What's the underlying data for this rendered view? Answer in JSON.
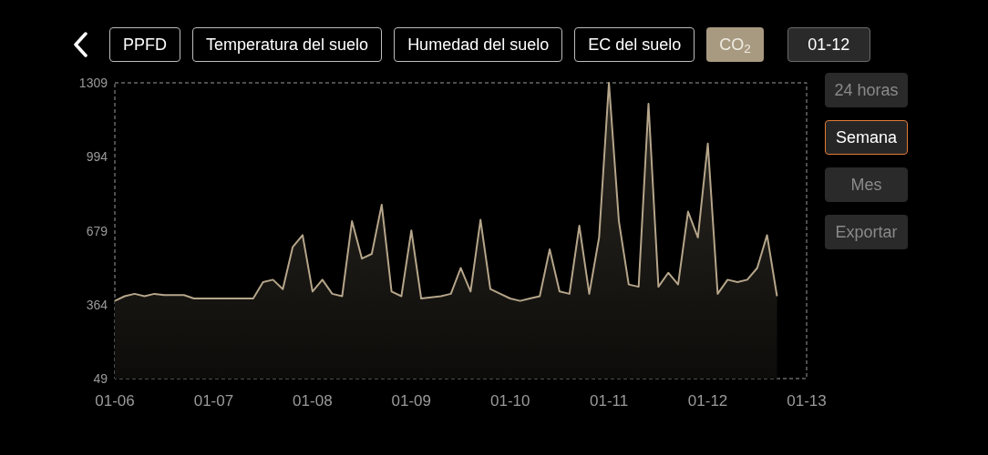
{
  "header": {
    "tabs": [
      {
        "label": "PPFD",
        "selected": false
      },
      {
        "label": "Temperatura del suelo",
        "selected": false
      },
      {
        "label": "Humedad del suelo",
        "selected": false
      },
      {
        "label": "EC del suelo",
        "selected": false
      },
      {
        "label": "CO$_{2}$",
        "selected": true
      }
    ],
    "date": "01-12"
  },
  "range_options": [
    {
      "label": "24 horas",
      "selected": false
    },
    {
      "label": "Semana",
      "selected": true
    },
    {
      "label": "Mes",
      "selected": false
    }
  ],
  "export_button": "Exportar",
  "chart": {
    "chart_data": {
      "type": "area",
      "ylim": [
        49,
        1309
      ],
      "yticks": [
        49,
        364,
        679,
        994,
        1309
      ],
      "categories": [
        "01-06",
        null,
        null,
        null,
        null,
        null,
        null,
        null,
        null,
        null,
        "01-07",
        null,
        null,
        null,
        null,
        null,
        null,
        null,
        null,
        null,
        "01-08",
        null,
        null,
        null,
        null,
        null,
        null,
        null,
        null,
        null,
        "01-09",
        null,
        null,
        null,
        null,
        null,
        null,
        null,
        null,
        null,
        "01-10",
        null,
        null,
        null,
        null,
        null,
        null,
        null,
        null,
        null,
        "01-11",
        null,
        null,
        null,
        null,
        null,
        null,
        null,
        null,
        null,
        "01-12",
        null,
        null,
        null,
        null,
        null,
        null,
        null,
        null,
        null,
        "01-13"
      ],
      "series": [
        {
          "color": "#b5a58a",
          "values": [
            380,
            400,
            410,
            400,
            410,
            405,
            405,
            405,
            390,
            390,
            390,
            390,
            390,
            390,
            390,
            460,
            470,
            430,
            610,
            660,
            420,
            470,
            410,
            400,
            720,
            560,
            580,
            790,
            420,
            400,
            680,
            390,
            395,
            400,
            410,
            520,
            420,
            725,
            430,
            410,
            390,
            380,
            390,
            400,
            600,
            420,
            410,
            700,
            410,
            650,
            1309,
            720,
            450,
            440,
            1220,
            440,
            500,
            450,
            760,
            650,
            1050,
            410,
            470,
            460,
            470,
            520,
            660,
            400,
            null,
            null,
            null
          ]
        }
      ]
    }
  }
}
